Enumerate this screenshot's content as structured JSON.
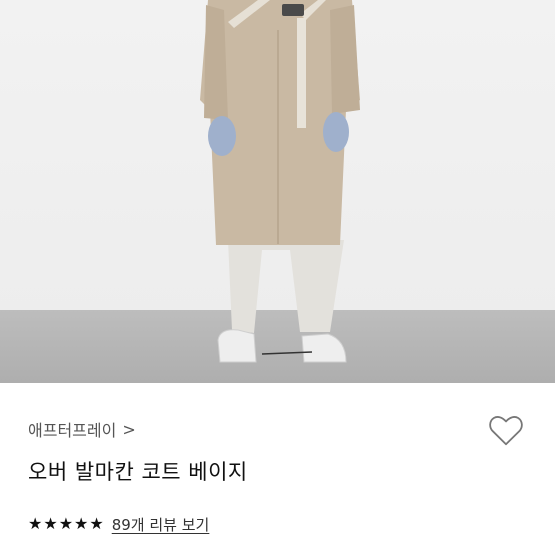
{
  "product": {
    "brand": "애프터프레이",
    "brand_chevron": ">",
    "title": "오버 발마칸 코트 베이지",
    "rating": {
      "stars": 5,
      "review_link": "89개 리뷰 보기"
    }
  },
  "icons": {
    "brand_chevron": "chevron-right-icon",
    "wishlist": "heart-outline-icon",
    "star": "star-icon"
  },
  "colors": {
    "coat": "#c8b8a2",
    "text": "#111111",
    "muted": "#555555"
  }
}
